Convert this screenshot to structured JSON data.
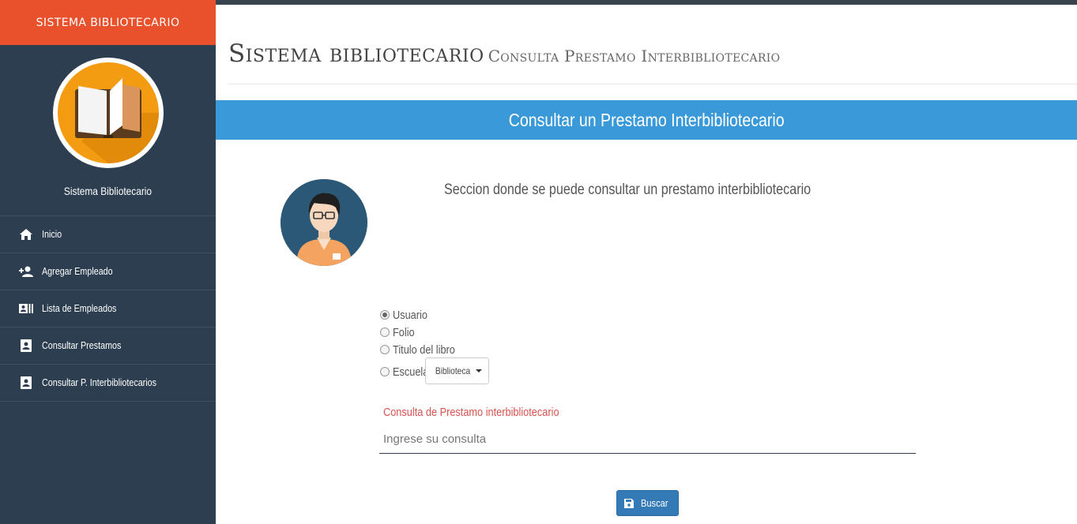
{
  "sidebar": {
    "brand": "SISTEMA BIBLIOTECARIO",
    "profile_name": "Sistema Bibliotecario",
    "items": [
      {
        "label": "Inicio",
        "icon": "home-icon"
      },
      {
        "label": "Agregar Empleado",
        "icon": "person-add-icon"
      },
      {
        "label": "Lista de Empleados",
        "icon": "contact-card-icon"
      },
      {
        "label": "Consultar Prestamos",
        "icon": "portrait-icon"
      },
      {
        "label": "Consultar P. Interbibliotecarios",
        "icon": "portrait-icon"
      }
    ]
  },
  "header": {
    "title": "Sistema bibliotecario",
    "subtitle": "Consulta Prestamo Interbibliotecario"
  },
  "banner": {
    "text": "Consultar un Prestamo Interbibliotecario"
  },
  "section": {
    "description": "Seccion donde se puede consultar un prestamo interbibliotecario"
  },
  "filters": {
    "options": [
      {
        "label": "Usuario",
        "checked": true
      },
      {
        "label": "Folio",
        "checked": false
      },
      {
        "label": "Titulo del libro",
        "checked": false
      },
      {
        "label": "Escuela",
        "checked": false
      }
    ],
    "dropdown_label": "Biblioteca"
  },
  "query": {
    "label": "Consulta de Prestamo interbibliotecario",
    "placeholder": "Ingrese su consulta",
    "value": ""
  },
  "search_button": {
    "label": "Buscar",
    "icon": "save-icon"
  },
  "colors": {
    "sidebar_bg": "#2c3e50",
    "brand_bg": "#e8512b",
    "banner_bg": "#3a9ad9",
    "button_bg": "#337ab7",
    "label_red": "#d9534f"
  }
}
